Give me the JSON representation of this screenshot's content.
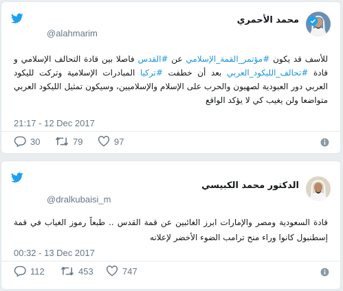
{
  "colors": {
    "accent": "#1da1f2",
    "hashtag": "#1b95e0",
    "muted": "#657786"
  },
  "tweets": [
    {
      "author_name": "محمد الأحمري",
      "handle": "@alahmarim",
      "verified": true,
      "avatar_icon": "profile-photo",
      "body": {
        "p1": "للأسف قد يكون ",
        "h1": "#مؤتمر_القمة_الإسلامي",
        "p2": " عن ",
        "h2": "#القدس",
        "p3": " فاصلا بين قادة التحالف الإسلامي و قادة ",
        "h3": "#تحالف_الليكود_العربي",
        "p4": " بعد أن خطفت ",
        "h4": "#تركيا",
        "p5": " المبادرات الإسلامية وتركت لليكود العربي دور العبودية لصهيون والحرب على الإسلام والإسلاميين، وسيكون تمثيل الليكود العربي متواضعا ولن يغيب كي لا يؤكد الواقع"
      },
      "timestamp": "21:17 - 12 Dec 2017",
      "replies": "30",
      "retweets": "79",
      "likes": "97"
    },
    {
      "author_name": "الدكتور محمد الكبيسي",
      "handle": "@dralkubaisi_m",
      "verified": false,
      "avatar_icon": "profile-photo",
      "body": {
        "p1": "قادة السعودية ومصر والإمارات ابرز الغائبين عن قمة القدس .. طبعاً رموز الغياب في قمة إسطنبول كانوا وراء منح ترامب الضوء الأخضر لإعلانه"
      },
      "timestamp": "00:32 - 13 Dec 2017",
      "replies": "112",
      "retweets": "453",
      "likes": "747"
    }
  ],
  "icons": {
    "bird": "twitter-bird-icon",
    "reply": "reply-icon",
    "retweet": "retweet-icon",
    "like": "heart-icon",
    "info": "info-icon",
    "verified": "verified-badge-icon"
  }
}
